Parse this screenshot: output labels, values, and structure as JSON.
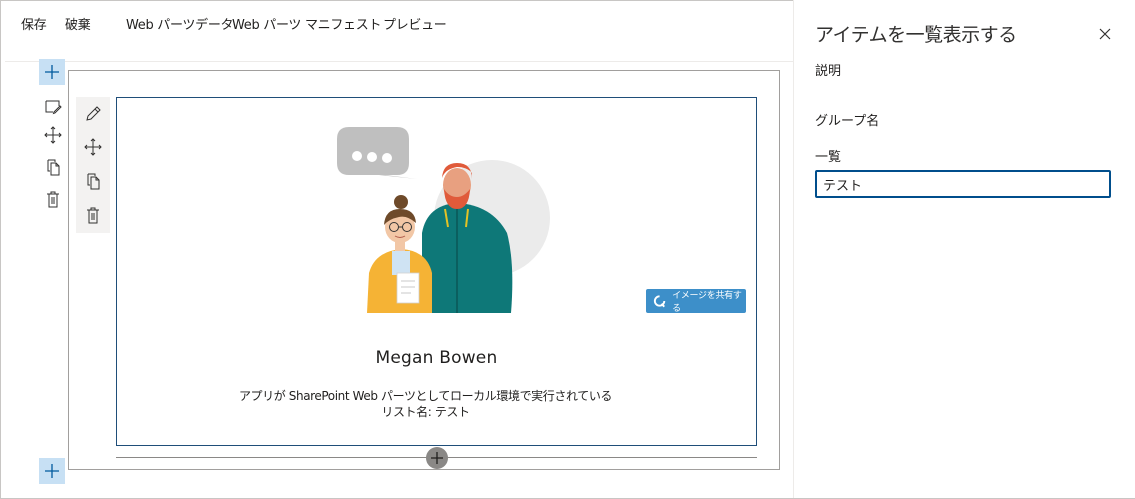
{
  "toolbar": {
    "save_label": "保存",
    "discard_label": "破棄",
    "webpart_data_label": "Web パーツデータ",
    "webpart_manifest_label": "Web パーツ マニフェスト",
    "preview_label": "プレビュー"
  },
  "panel": {
    "title": "アイテムを一覧表示する",
    "description_label": "説明",
    "group_name_label": "グループ名",
    "list_label": "一覧",
    "list_value": "テスト"
  },
  "webpart": {
    "share_button_label": "イメージを共有する",
    "user_name": "Megan Bowen",
    "description_line1": "アプリが SharePoint Web パーツとしてローカル環境で実行されている",
    "description_line2": "リスト名: テスト"
  },
  "icons": {
    "add": "plus-icon",
    "edit_section": "edit-section-icon",
    "move": "move-icon",
    "copy": "copy-icon",
    "delete": "trash-icon",
    "edit": "pencil-icon",
    "close": "close-icon",
    "share": "share-icon"
  },
  "colors": {
    "accent": "#004e8c",
    "add_button_bg": "#c7e0f4",
    "share_button_bg": "#3d8fc9",
    "webpart_border": "#1f4e79"
  }
}
